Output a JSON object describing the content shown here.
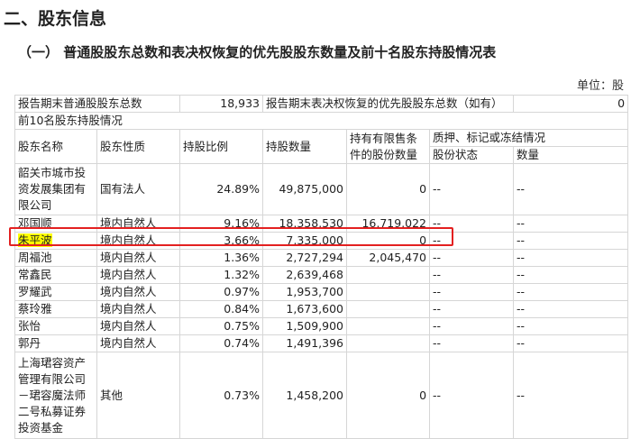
{
  "section_title": "二、股东信息",
  "subsection_title": "（一）  普通股股东总数和表决权恢复的优先股股东数量及前十名股东持股情况表",
  "unit_label": "单位：股",
  "summary": {
    "label_total": "报告期末普通股股东总数",
    "value_total": "18,933",
    "label_pref": "报告期末表决权恢复的优先股股东总数（如有）",
    "value_pref": "0"
  },
  "top10_caption": "前10名股东持股情况",
  "headers": {
    "name": "股东名称",
    "nature": "股东性质",
    "ratio": "持股比例",
    "qty": "持股数量",
    "restricted": "持有有限售条件的股份数量",
    "pledge_group": "质押、标记或冻结情况",
    "share_status": "股份状态",
    "pledge_qty": "数量"
  },
  "rows": [
    {
      "name": "韶关市城市投资发展集团有限公司",
      "nature": "国有法人",
      "ratio": "24.89%",
      "qty": "49,875,000",
      "restricted": "0",
      "status": "--",
      "pqty": "--"
    },
    {
      "name": "邓国顺",
      "nature": "境内自然人",
      "ratio": "9.16%",
      "qty": "18,358,530",
      "restricted": "16,719,022",
      "status": "--",
      "pqty": "--"
    },
    {
      "name": "朱平波",
      "nature": "境内自然人",
      "ratio": "3.66%",
      "qty": "7,335,000",
      "restricted": "0",
      "status": "--",
      "pqty": "--"
    },
    {
      "name": "周福池",
      "nature": "境内自然人",
      "ratio": "1.36%",
      "qty": "2,727,294",
      "restricted": "2,045,470",
      "status": "--",
      "pqty": "--"
    },
    {
      "name": "常鑫民",
      "nature": "境内自然人",
      "ratio": "1.32%",
      "qty": "2,639,468",
      "restricted": "",
      "status": "--",
      "pqty": "--"
    },
    {
      "name": "罗耀武",
      "nature": "境内自然人",
      "ratio": "0.97%",
      "qty": "1,953,700",
      "restricted": "",
      "status": "--",
      "pqty": "--"
    },
    {
      "name": "蔡玲雅",
      "nature": "境内自然人",
      "ratio": "0.84%",
      "qty": "1,673,600",
      "restricted": "",
      "status": "--",
      "pqty": "--"
    },
    {
      "name": "张怡",
      "nature": "境内自然人",
      "ratio": "0.75%",
      "qty": "1,509,900",
      "restricted": "",
      "status": "--",
      "pqty": "--"
    },
    {
      "name": "郭丹",
      "nature": "境内自然人",
      "ratio": "0.74%",
      "qty": "1,491,396",
      "restricted": "",
      "status": "--",
      "pqty": "--"
    },
    {
      "name": "上海珺容资产管理有限公司－珺容魔法师二号私募证券投资基金",
      "nature": "其他",
      "ratio": "0.73%",
      "qty": "1,458,200",
      "restricted": "0",
      "status": "--",
      "pqty": "--"
    }
  ],
  "highlight": {
    "row_index": 2,
    "color": "#ffff00",
    "box_color": "#e32020"
  }
}
